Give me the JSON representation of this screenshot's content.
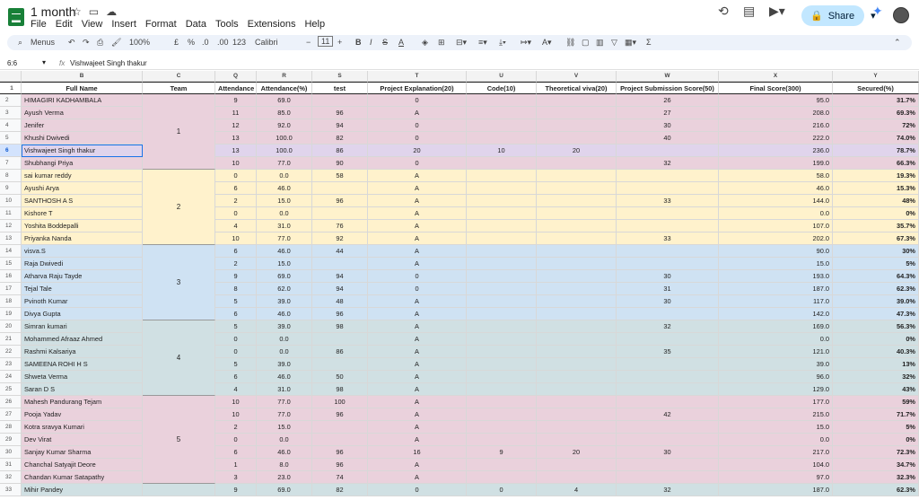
{
  "app": {
    "title": "1 month",
    "menus": [
      "File",
      "Edit",
      "View",
      "Insert",
      "Format",
      "Data",
      "Tools",
      "Extensions",
      "Help"
    ],
    "share_label": "Share"
  },
  "toolbar": {
    "search": "Menus",
    "zoom": "100%",
    "currency": "£",
    "percent": "%",
    "dec_less": ".0",
    "dec_more": ".00",
    "numfmt": "123",
    "font": "Calibri",
    "font_size": "11"
  },
  "formula": {
    "cell": "6:6",
    "fx": "fx",
    "value": "Vishwajeet Singh thakur"
  },
  "columns": [
    "B",
    "C",
    "Q",
    "R",
    "S",
    "T",
    "U",
    "V",
    "W",
    "X",
    "Y"
  ],
  "headers": [
    "Full Name",
    "Team",
    "Attendance",
    "Attendance(%)",
    "test",
    "Project Explanation(20)",
    "Code(10)",
    "Theoretical viva(20)",
    "Project Submission Score(50)",
    "Final Score(300)",
    "Secured(%)"
  ],
  "rows": [
    {
      "n": "2",
      "g": 1,
      "v": [
        "HIMAGIRI KADHAMBALA",
        "",
        "9",
        "69.0",
        "",
        "0",
        "",
        "",
        "26",
        "95.0",
        "31.7%"
      ]
    },
    {
      "n": "3",
      "g": 1,
      "v": [
        "Ayush Verma",
        "",
        "11",
        "85.0",
        "96",
        "A",
        "",
        "",
        "27",
        "208.0",
        "69.3%"
      ]
    },
    {
      "n": "4",
      "g": 1,
      "v": [
        "Jenifer",
        "",
        "12",
        "92.0",
        "94",
        "0",
        "",
        "",
        "30",
        "216.0",
        "72%"
      ]
    },
    {
      "n": "5",
      "g": 1,
      "v": [
        "Khushi Dwivedi",
        "",
        "13",
        "100.0",
        "82",
        "0",
        "",
        "",
        "40",
        "222.0",
        "74.0%"
      ]
    },
    {
      "n": "6",
      "g": 1,
      "v": [
        "Vishwajeet Singh thakur",
        "",
        "13",
        "100.0",
        "86",
        "20",
        "10",
        "20",
        "",
        "236.0",
        "78.7%"
      ]
    },
    {
      "n": "7",
      "g": 1,
      "v": [
        "Shubhangi Priya",
        "",
        "10",
        "77.0",
        "90",
        "0",
        "",
        "",
        "32",
        "199.0",
        "66.3%"
      ]
    },
    {
      "n": "8",
      "g": 2,
      "v": [
        "sai kumar reddy",
        "",
        "0",
        "0.0",
        "58",
        "A",
        "",
        "",
        "",
        "58.0",
        "19.3%"
      ]
    },
    {
      "n": "9",
      "g": 2,
      "v": [
        "Ayushi Arya",
        "",
        "6",
        "46.0",
        "",
        "A",
        "",
        "",
        "",
        "46.0",
        "15.3%"
      ]
    },
    {
      "n": "10",
      "g": 2,
      "v": [
        "SANTHOSH A S",
        "",
        "2",
        "15.0",
        "96",
        "A",
        "",
        "",
        "33",
        "144.0",
        "48%"
      ]
    },
    {
      "n": "11",
      "g": 2,
      "v": [
        "Kishore T",
        "",
        "0",
        "0.0",
        "",
        "A",
        "",
        "",
        "",
        "0.0",
        "0%"
      ]
    },
    {
      "n": "12",
      "g": 2,
      "v": [
        "Yoshita Boddepalli",
        "",
        "4",
        "31.0",
        "76",
        "A",
        "",
        "",
        "",
        "107.0",
        "35.7%"
      ]
    },
    {
      "n": "13",
      "g": 2,
      "v": [
        "Priyanka Nanda",
        "",
        "10",
        "77.0",
        "92",
        "A",
        "",
        "",
        "33",
        "202.0",
        "67.3%"
      ]
    },
    {
      "n": "14",
      "g": 3,
      "v": [
        "visva.S",
        "",
        "6",
        "46.0",
        "44",
        "A",
        "",
        "",
        "",
        "90.0",
        "30%"
      ]
    },
    {
      "n": "15",
      "g": 3,
      "v": [
        "Raja Dwivedi",
        "",
        "2",
        "15.0",
        "",
        "A",
        "",
        "",
        "",
        "15.0",
        "5%"
      ]
    },
    {
      "n": "16",
      "g": 3,
      "v": [
        "Atharva Raju Tayde",
        "",
        "9",
        "69.0",
        "94",
        "0",
        "",
        "",
        "30",
        "193.0",
        "64.3%"
      ]
    },
    {
      "n": "17",
      "g": 3,
      "v": [
        "Tejal Tale",
        "",
        "8",
        "62.0",
        "94",
        "0",
        "",
        "",
        "31",
        "187.0",
        "62.3%"
      ]
    },
    {
      "n": "18",
      "g": 3,
      "v": [
        "Pvinoth Kumar",
        "",
        "5",
        "39.0",
        "48",
        "A",
        "",
        "",
        "30",
        "117.0",
        "39.0%"
      ]
    },
    {
      "n": "19",
      "g": 3,
      "v": [
        "Divya Gupta",
        "",
        "6",
        "46.0",
        "96",
        "A",
        "",
        "",
        "",
        "142.0",
        "47.3%"
      ]
    },
    {
      "n": "20",
      "g": 4,
      "v": [
        "Simran kumari",
        "",
        "5",
        "39.0",
        "98",
        "A",
        "",
        "",
        "32",
        "169.0",
        "56.3%"
      ]
    },
    {
      "n": "21",
      "g": 4,
      "v": [
        "Mohammed Afraaz Ahmed",
        "",
        "0",
        "0.0",
        "",
        "A",
        "",
        "",
        "",
        "0.0",
        "0%"
      ]
    },
    {
      "n": "22",
      "g": 4,
      "v": [
        "Rashmi Kalsariya",
        "",
        "0",
        "0.0",
        "86",
        "A",
        "",
        "",
        "35",
        "121.0",
        "40.3%"
      ]
    },
    {
      "n": "23",
      "g": 4,
      "v": [
        "SAMEENA ROHI H S",
        "",
        "5",
        "39.0",
        "",
        "A",
        "",
        "",
        "",
        "39.0",
        "13%"
      ]
    },
    {
      "n": "24",
      "g": 4,
      "v": [
        "Shweta Verma",
        "",
        "6",
        "46.0",
        "50",
        "A",
        "",
        "",
        "",
        "96.0",
        "32%"
      ]
    },
    {
      "n": "25",
      "g": 4,
      "v": [
        "Saran D S",
        "",
        "4",
        "31.0",
        "98",
        "A",
        "",
        "",
        "",
        "129.0",
        "43%"
      ]
    },
    {
      "n": "26",
      "g": 5,
      "v": [
        "Mahesh Pandurang Tejam",
        "",
        "10",
        "77.0",
        "100",
        "A",
        "",
        "",
        "",
        "177.0",
        "59%"
      ]
    },
    {
      "n": "27",
      "g": 5,
      "v": [
        "Pooja Yadav",
        "",
        "10",
        "77.0",
        "96",
        "A",
        "",
        "",
        "42",
        "215.0",
        "71.7%"
      ]
    },
    {
      "n": "28",
      "g": 5,
      "v": [
        "Kotra sravya Kumari",
        "",
        "2",
        "15.0",
        "",
        "A",
        "",
        "",
        "",
        "15.0",
        "5%"
      ]
    },
    {
      "n": "29",
      "g": 5,
      "v": [
        "Dev Virat",
        "",
        "0",
        "0.0",
        "",
        "A",
        "",
        "",
        "",
        "0.0",
        "0%"
      ]
    },
    {
      "n": "30",
      "g": 5,
      "v": [
        "Sanjay Kumar Sharma",
        "",
        "6",
        "46.0",
        "96",
        "16",
        "9",
        "20",
        "30",
        "217.0",
        "72.3%"
      ]
    },
    {
      "n": "31",
      "g": 5,
      "v": [
        "Chanchal Satyajit Deore",
        "",
        "1",
        "8.0",
        "96",
        "A",
        "",
        "",
        "",
        "104.0",
        "34.7%"
      ]
    },
    {
      "n": "32",
      "g": 5,
      "v": [
        "Chandan Kumar Satapathy",
        "",
        "3",
        "23.0",
        "74",
        "A",
        "",
        "",
        "",
        "97.0",
        "32.3%"
      ]
    },
    {
      "n": "33",
      "g": 4,
      "v": [
        "Mihir Pandey",
        "",
        "9",
        "69.0",
        "82",
        "0",
        "0",
        "4",
        "32",
        "187.0",
        "62.3%"
      ]
    }
  ],
  "teams": [
    {
      "label": "1",
      "start": 0,
      "len": 6
    },
    {
      "label": "2",
      "start": 6,
      "len": 6
    },
    {
      "label": "3",
      "start": 12,
      "len": 6
    },
    {
      "label": "4",
      "start": 18,
      "len": 6
    },
    {
      "label": "5",
      "start": 24,
      "len": 7
    }
  ],
  "selected_row": "6"
}
